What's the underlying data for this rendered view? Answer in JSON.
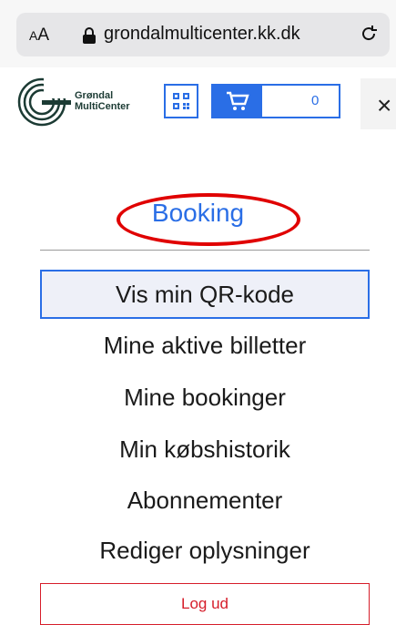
{
  "browser": {
    "aa_label_small": "A",
    "aa_label_large": "A",
    "url": "grondalmulticenter.kk.dk"
  },
  "header": {
    "logo_line1": "Grøndal",
    "logo_line2": "MultiCenter",
    "cart_count": "0",
    "close_label": "×"
  },
  "menu": {
    "title": "Booking",
    "items": [
      {
        "label": "Vis min QR-kode"
      },
      {
        "label": "Mine aktive billetter"
      },
      {
        "label": "Mine bookinger"
      },
      {
        "label": "Min købshistorik"
      },
      {
        "label": "Abonnementer"
      },
      {
        "label": "Rediger oplysninger"
      }
    ],
    "logout_label": "Log ud"
  },
  "colors": {
    "accent": "#2a6ee6",
    "annotation_circle": "#e00000",
    "logout": "#d61d2a"
  },
  "icons": {
    "lock": "lock-icon",
    "reload": "reload-icon",
    "qr": "qr-code-icon",
    "cart": "cart-icon"
  }
}
